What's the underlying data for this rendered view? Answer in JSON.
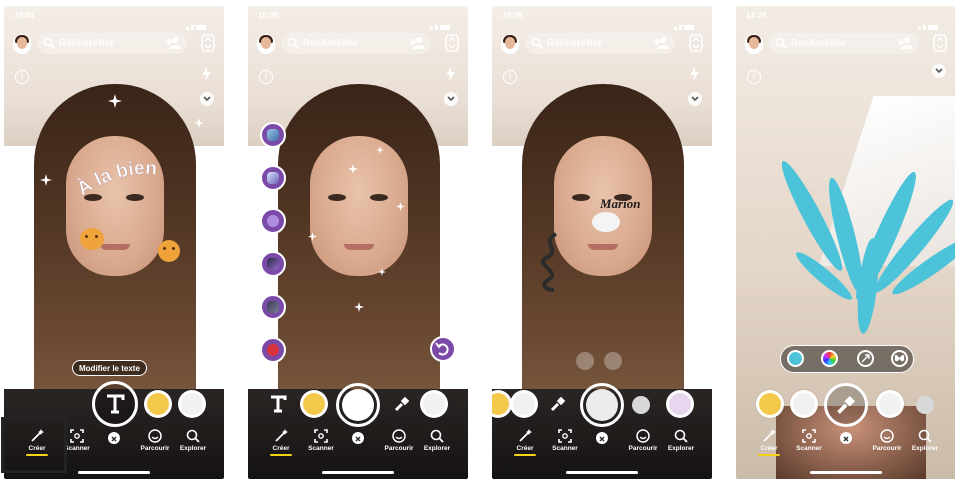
{
  "status_times": [
    "10:04",
    "10:05",
    "10:08",
    "14:29"
  ],
  "search": {
    "placeholder": "Rechercher"
  },
  "nav": {
    "create": "Créer",
    "scan": "Scanner",
    "browse": "Parcourir",
    "explore": "Explorer"
  },
  "phone1": {
    "curved_text": "À la bien",
    "edit_text_button": "Modifier le texte"
  },
  "phone3": {
    "tattoo_text": "Marion"
  },
  "colors": {
    "accent_underline": "#f3d21a",
    "side_tool_purple": "#7b4aa8",
    "plant_teal": "#4cc3d9",
    "ui_white": "#ffffff",
    "highlight_frame": "#232323"
  },
  "icons": [
    "avatar-icon",
    "search-icon",
    "add-friend-icon",
    "flip-camera-icon",
    "info-icon",
    "flash-icon",
    "chevron-down-icon",
    "wand-icon",
    "scan-icon",
    "close-icon",
    "smiley-icon",
    "explore-icon",
    "text-tool-icon",
    "brush-icon",
    "undo-icon"
  ]
}
